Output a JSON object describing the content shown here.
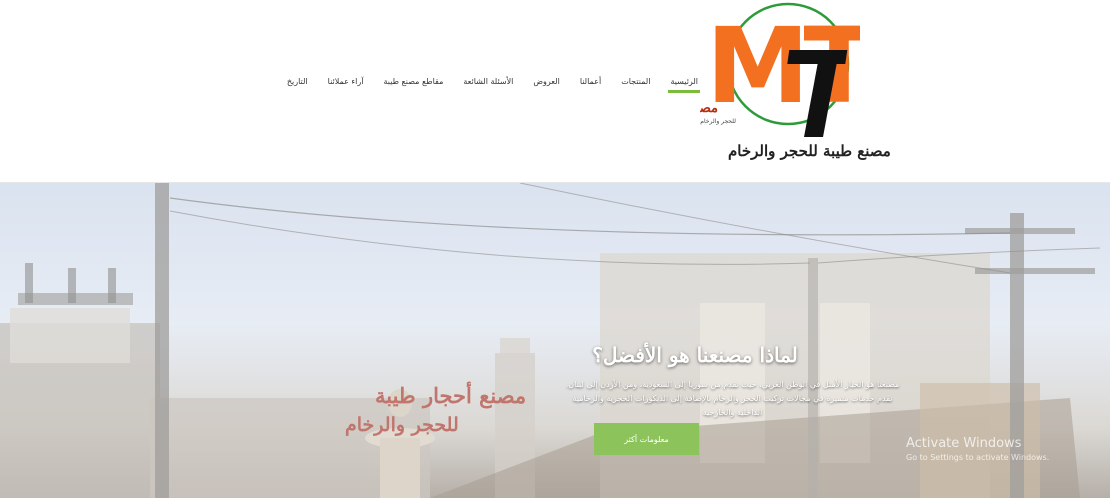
{
  "theme": {
    "accent": "#7dbb3b",
    "button": "#8dc35b",
    "logo_orange": "#f37021",
    "logo_ring": "#2e9b3a"
  },
  "logo": {
    "letters": "MT",
    "arabic_mark": "مصنع طيبة",
    "arabic_sub": "للحجر والرخام",
    "caption": "مصنع طيبة للحجر والرخام"
  },
  "nav": {
    "items": [
      {
        "label": "الرئيسية",
        "active": true
      },
      {
        "label": "المنتجات"
      },
      {
        "label": "أعمالنا"
      },
      {
        "label": "العروض"
      },
      {
        "label": "الأسئلة الشائعة"
      },
      {
        "label": "مقاطع مصنع طيبة"
      },
      {
        "label": "آراء عملائنا"
      },
      {
        "label": "التاريخ"
      }
    ]
  },
  "hero": {
    "title": "لماذا مصنعنا هو الأفضل؟",
    "text": "مصنعنا هو الخيار الأمثل في الوطن العربي، حيث نقدم من سوريا إلى السعودية، ومن الأردن إلى لبنان. نقدم خدمات متميزة في مجالات تركيب الحجر والرخام بالإضافة إلى الديكورات الحجرية والرخامية الداخلية والخارجية",
    "button": "معلومات أكثر",
    "sign_line1": "مصنع أحجار طيبة",
    "sign_line2": "للحجر والرخام"
  },
  "watermark": {
    "title": "Activate Windows",
    "subtitle": "Go to Settings to activate Windows."
  }
}
